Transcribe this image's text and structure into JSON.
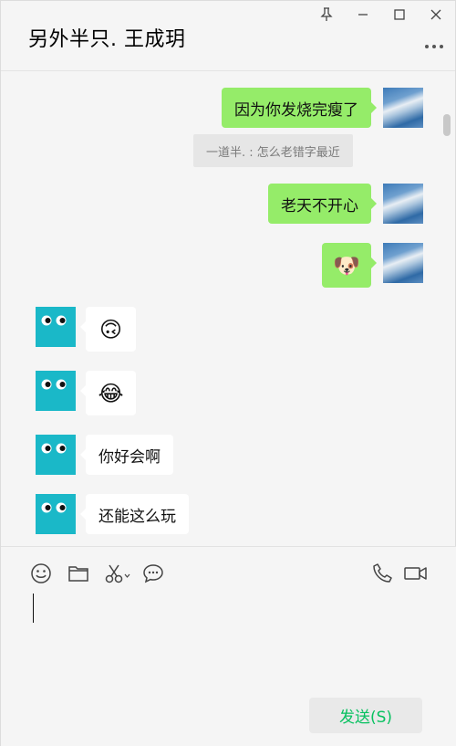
{
  "chat": {
    "title": "另外半只. 王成玥"
  },
  "window_controls": {
    "pin": "pin-icon",
    "minimize": "minimize-icon",
    "maximize": "maximize-icon",
    "close": "close-icon"
  },
  "messages": [
    {
      "side": "sent",
      "type": "text",
      "text": "因为你发烧完瘦了"
    },
    {
      "type": "quote",
      "text": "一道半. : 怎么老错字最近"
    },
    {
      "side": "sent",
      "type": "text",
      "text": "老天不开心"
    },
    {
      "side": "sent",
      "type": "emoji",
      "text": "🐶"
    },
    {
      "side": "received",
      "type": "emoji",
      "text": "🙃"
    },
    {
      "side": "received",
      "type": "emoji",
      "text": "😂"
    },
    {
      "side": "received",
      "type": "text",
      "text": "你好会啊"
    },
    {
      "side": "received",
      "type": "text",
      "text": "还能这么玩"
    }
  ],
  "toolbar": {
    "left": [
      "emoji-icon",
      "folder-icon",
      "scissors-icon",
      "chat-bubble-icon"
    ],
    "right": [
      "phone-icon",
      "video-icon"
    ]
  },
  "composer": {
    "send_label": "发送(S)"
  },
  "colors": {
    "sent_bubble": "#95ec69",
    "send_text": "#07c160",
    "avatar_contact": "#1ab8c8"
  }
}
